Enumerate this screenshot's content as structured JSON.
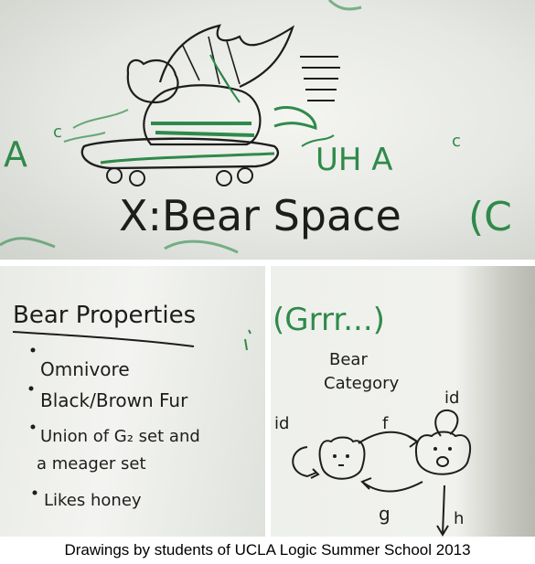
{
  "top_panel": {
    "title": "X:Bear Space",
    "label_left": "A",
    "label_left_sup": "c",
    "label_right": "UH A",
    "label_right_sup": "c",
    "paren": "(C"
  },
  "left_panel": {
    "heading": "Bear Properties",
    "items": [
      "Omnivore",
      "Black/Brown Fur",
      "Union of G₂ set and",
      "a meager set",
      "Likes honey"
    ]
  },
  "right_panel": {
    "growl": "(Grrr...)",
    "category_line1": "Bear",
    "category_line2": "Category",
    "id_left": "id",
    "id_right": "id",
    "arrow_f": "f",
    "arrow_g": "g",
    "arrow_h": "h"
  },
  "caption": "Drawings by students of UCLA Logic Summer School 2013"
}
